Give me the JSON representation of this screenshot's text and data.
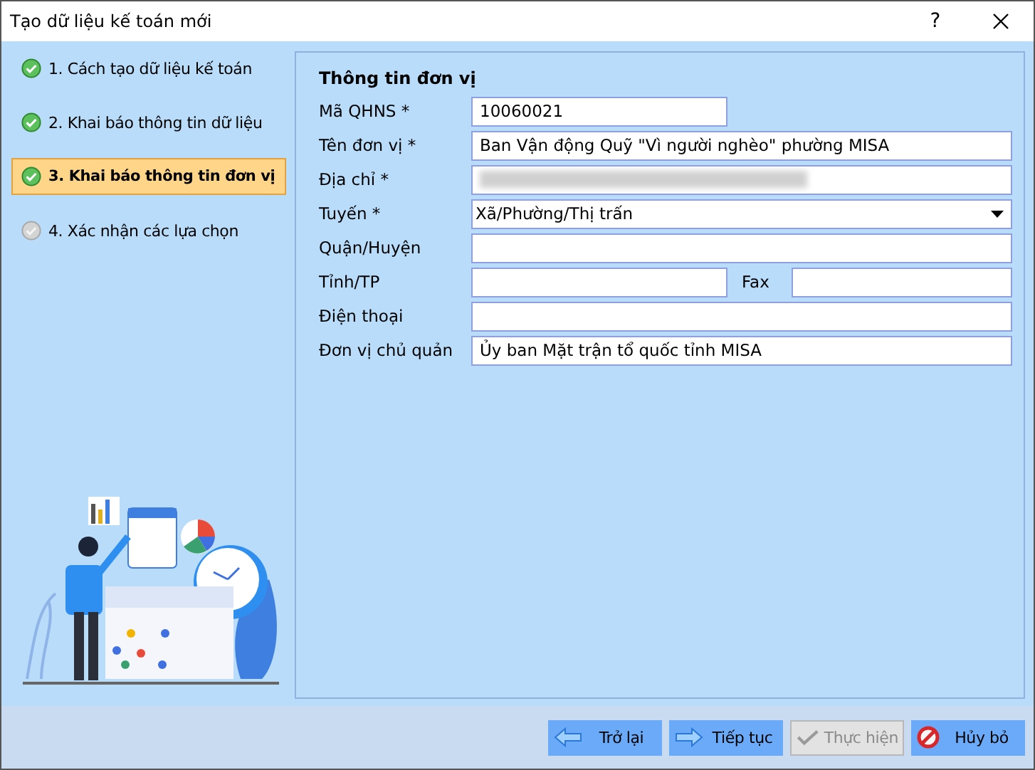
{
  "window": {
    "title": "Tạo dữ liệu kế toán mới",
    "help": "?"
  },
  "steps": [
    {
      "label": "1. Cách tạo dữ liệu kế toán",
      "done": true,
      "selected": false
    },
    {
      "label": "2. Khai báo thông tin dữ liệu",
      "done": true,
      "selected": false
    },
    {
      "label": "3. Khai báo thông tin đơn vị",
      "done": true,
      "selected": true
    },
    {
      "label": "4. Xác nhận các lựa chọn",
      "done": false,
      "selected": false
    }
  ],
  "form": {
    "title": "Thông tin đơn vị",
    "rows": [
      {
        "kind": "short",
        "label": "Mã QHNS *",
        "value": "10060021"
      },
      {
        "kind": "text",
        "label": "Tên đơn vị *",
        "value": "Ban Vận động Quỹ \"Vì người nghèo\" phường MISA"
      },
      {
        "kind": "redacted",
        "label": "Địa chỉ *"
      },
      {
        "kind": "select",
        "label": "Tuyến *",
        "value": "Xã/Phường/Thị trấn"
      },
      {
        "kind": "text",
        "label": "Quận/Huyện"
      },
      {
        "kind": "pair",
        "label": "Tỉnh/TP",
        "label_2": "Fax"
      },
      {
        "kind": "text",
        "label": "Điện thoại"
      },
      {
        "kind": "text",
        "label": "Đơn vị chủ quản",
        "value": "Ủy ban Mặt trận tổ quốc tỉnh MISA"
      }
    ]
  },
  "buttons": [
    {
      "kind": "back",
      "label": "Trở lại",
      "disabled": false
    },
    {
      "kind": "next",
      "label": "Tiếp tục",
      "disabled": false
    },
    {
      "kind": "finish",
      "label": "Thực hiện",
      "disabled": true
    },
    {
      "kind": "cancel",
      "label": "Hủy bỏ",
      "disabled": false
    }
  ]
}
